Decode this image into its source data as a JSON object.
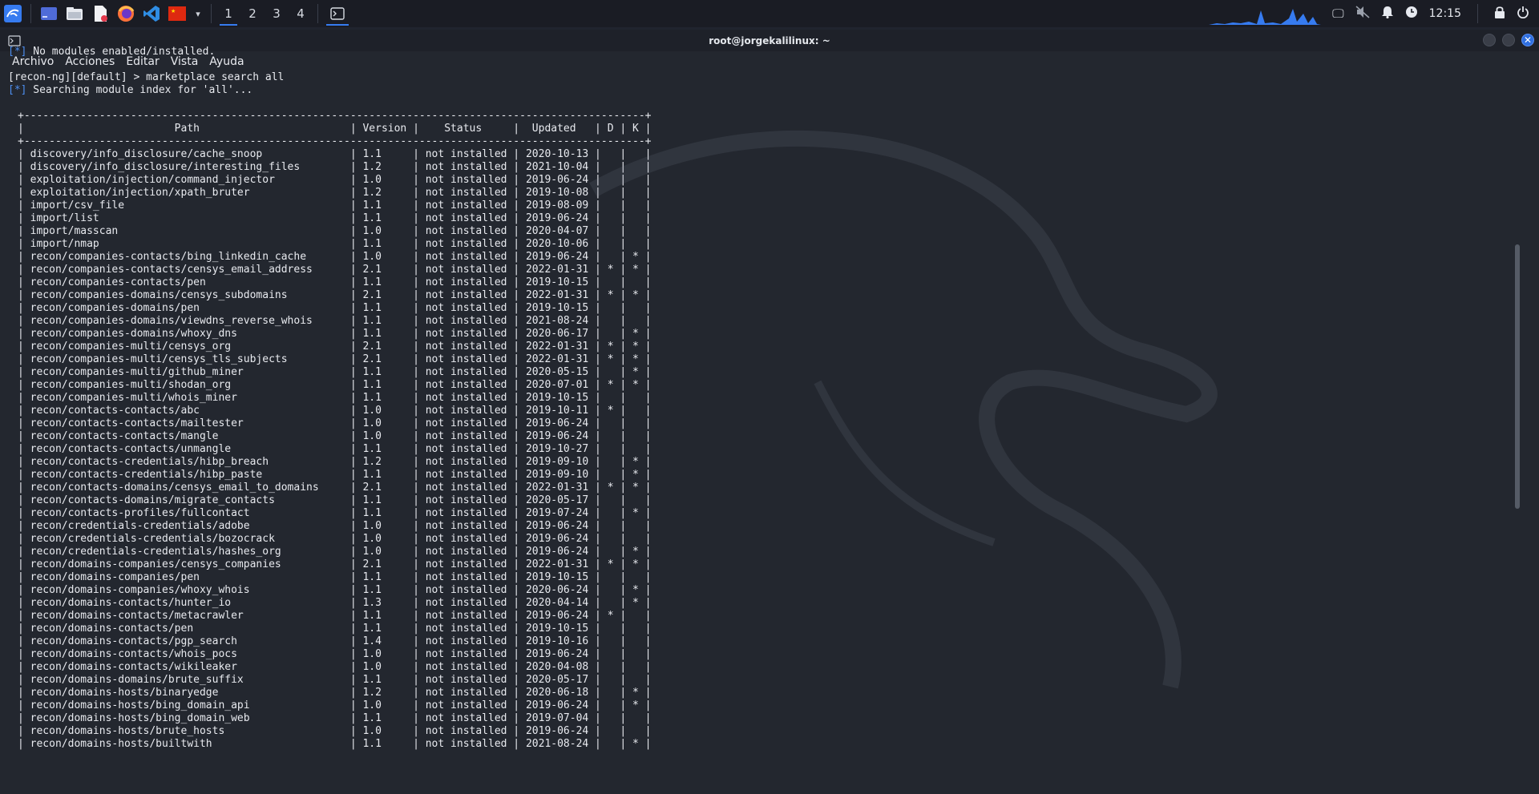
{
  "taskbar": {
    "workspaces": [
      "1",
      "2",
      "3",
      "4"
    ],
    "active_workspace": "1",
    "clock": "12:15",
    "apps": [
      "kali-menu-icon",
      "workspace-manager-icon",
      "file-manager-icon",
      "text-editor-icon",
      "firefox-icon",
      "vscode-icon",
      "flag-icon"
    ]
  },
  "window": {
    "title": "root@jorgekalilinux: ~",
    "menu": [
      "Archivo",
      "Acciones",
      "Editar",
      "Vista",
      "Ayuda"
    ]
  },
  "terminal": {
    "pre_lines": [
      {
        "prefix": "[*]",
        "text": " No modules enabled/installed."
      },
      {
        "prefix": "",
        "text": ""
      },
      {
        "prefix": "",
        "text": "[recon-ng][default] > marketplace search all"
      },
      {
        "prefix": "[*]",
        "text": " Searching module index for 'all'..."
      },
      {
        "prefix": "",
        "text": ""
      }
    ],
    "table_header": {
      "path": "Path",
      "version": "Version",
      "status": "Status",
      "updated": "Updated",
      "d": "D",
      "k": "K"
    },
    "rows": [
      {
        "path": "discovery/info_disclosure/cache_snoop",
        "version": "1.1",
        "status": "not installed",
        "updated": "2020-10-13",
        "d": "",
        "k": ""
      },
      {
        "path": "discovery/info_disclosure/interesting_files",
        "version": "1.2",
        "status": "not installed",
        "updated": "2021-10-04",
        "d": "",
        "k": ""
      },
      {
        "path": "exploitation/injection/command_injector",
        "version": "1.0",
        "status": "not installed",
        "updated": "2019-06-24",
        "d": "",
        "k": ""
      },
      {
        "path": "exploitation/injection/xpath_bruter",
        "version": "1.2",
        "status": "not installed",
        "updated": "2019-10-08",
        "d": "",
        "k": ""
      },
      {
        "path": "import/csv_file",
        "version": "1.1",
        "status": "not installed",
        "updated": "2019-08-09",
        "d": "",
        "k": ""
      },
      {
        "path": "import/list",
        "version": "1.1",
        "status": "not installed",
        "updated": "2019-06-24",
        "d": "",
        "k": ""
      },
      {
        "path": "import/masscan",
        "version": "1.0",
        "status": "not installed",
        "updated": "2020-04-07",
        "d": "",
        "k": ""
      },
      {
        "path": "import/nmap",
        "version": "1.1",
        "status": "not installed",
        "updated": "2020-10-06",
        "d": "",
        "k": ""
      },
      {
        "path": "recon/companies-contacts/bing_linkedin_cache",
        "version": "1.0",
        "status": "not installed",
        "updated": "2019-06-24",
        "d": "",
        "k": "*"
      },
      {
        "path": "recon/companies-contacts/censys_email_address",
        "version": "2.1",
        "status": "not installed",
        "updated": "2022-01-31",
        "d": "*",
        "k": "*"
      },
      {
        "path": "recon/companies-contacts/pen",
        "version": "1.1",
        "status": "not installed",
        "updated": "2019-10-15",
        "d": "",
        "k": ""
      },
      {
        "path": "recon/companies-domains/censys_subdomains",
        "version": "2.1",
        "status": "not installed",
        "updated": "2022-01-31",
        "d": "*",
        "k": "*"
      },
      {
        "path": "recon/companies-domains/pen",
        "version": "1.1",
        "status": "not installed",
        "updated": "2019-10-15",
        "d": "",
        "k": ""
      },
      {
        "path": "recon/companies-domains/viewdns_reverse_whois",
        "version": "1.1",
        "status": "not installed",
        "updated": "2021-08-24",
        "d": "",
        "k": ""
      },
      {
        "path": "recon/companies-domains/whoxy_dns",
        "version": "1.1",
        "status": "not installed",
        "updated": "2020-06-17",
        "d": "",
        "k": "*"
      },
      {
        "path": "recon/companies-multi/censys_org",
        "version": "2.1",
        "status": "not installed",
        "updated": "2022-01-31",
        "d": "*",
        "k": "*"
      },
      {
        "path": "recon/companies-multi/censys_tls_subjects",
        "version": "2.1",
        "status": "not installed",
        "updated": "2022-01-31",
        "d": "*",
        "k": "*"
      },
      {
        "path": "recon/companies-multi/github_miner",
        "version": "1.1",
        "status": "not installed",
        "updated": "2020-05-15",
        "d": "",
        "k": "*"
      },
      {
        "path": "recon/companies-multi/shodan_org",
        "version": "1.1",
        "status": "not installed",
        "updated": "2020-07-01",
        "d": "*",
        "k": "*"
      },
      {
        "path": "recon/companies-multi/whois_miner",
        "version": "1.1",
        "status": "not installed",
        "updated": "2019-10-15",
        "d": "",
        "k": ""
      },
      {
        "path": "recon/contacts-contacts/abc",
        "version": "1.0",
        "status": "not installed",
        "updated": "2019-10-11",
        "d": "*",
        "k": ""
      },
      {
        "path": "recon/contacts-contacts/mailtester",
        "version": "1.0",
        "status": "not installed",
        "updated": "2019-06-24",
        "d": "",
        "k": ""
      },
      {
        "path": "recon/contacts-contacts/mangle",
        "version": "1.0",
        "status": "not installed",
        "updated": "2019-06-24",
        "d": "",
        "k": ""
      },
      {
        "path": "recon/contacts-contacts/unmangle",
        "version": "1.1",
        "status": "not installed",
        "updated": "2019-10-27",
        "d": "",
        "k": ""
      },
      {
        "path": "recon/contacts-credentials/hibp_breach",
        "version": "1.2",
        "status": "not installed",
        "updated": "2019-09-10",
        "d": "",
        "k": "*"
      },
      {
        "path": "recon/contacts-credentials/hibp_paste",
        "version": "1.1",
        "status": "not installed",
        "updated": "2019-09-10",
        "d": "",
        "k": "*"
      },
      {
        "path": "recon/contacts-domains/censys_email_to_domains",
        "version": "2.1",
        "status": "not installed",
        "updated": "2022-01-31",
        "d": "*",
        "k": "*"
      },
      {
        "path": "recon/contacts-domains/migrate_contacts",
        "version": "1.1",
        "status": "not installed",
        "updated": "2020-05-17",
        "d": "",
        "k": ""
      },
      {
        "path": "recon/contacts-profiles/fullcontact",
        "version": "1.1",
        "status": "not installed",
        "updated": "2019-07-24",
        "d": "",
        "k": "*"
      },
      {
        "path": "recon/credentials-credentials/adobe",
        "version": "1.0",
        "status": "not installed",
        "updated": "2019-06-24",
        "d": "",
        "k": ""
      },
      {
        "path": "recon/credentials-credentials/bozocrack",
        "version": "1.0",
        "status": "not installed",
        "updated": "2019-06-24",
        "d": "",
        "k": ""
      },
      {
        "path": "recon/credentials-credentials/hashes_org",
        "version": "1.0",
        "status": "not installed",
        "updated": "2019-06-24",
        "d": "",
        "k": "*"
      },
      {
        "path": "recon/domains-companies/censys_companies",
        "version": "2.1",
        "status": "not installed",
        "updated": "2022-01-31",
        "d": "*",
        "k": "*"
      },
      {
        "path": "recon/domains-companies/pen",
        "version": "1.1",
        "status": "not installed",
        "updated": "2019-10-15",
        "d": "",
        "k": ""
      },
      {
        "path": "recon/domains-companies/whoxy_whois",
        "version": "1.1",
        "status": "not installed",
        "updated": "2020-06-24",
        "d": "",
        "k": "*"
      },
      {
        "path": "recon/domains-contacts/hunter_io",
        "version": "1.3",
        "status": "not installed",
        "updated": "2020-04-14",
        "d": "",
        "k": "*"
      },
      {
        "path": "recon/domains-contacts/metacrawler",
        "version": "1.1",
        "status": "not installed",
        "updated": "2019-06-24",
        "d": "*",
        "k": ""
      },
      {
        "path": "recon/domains-contacts/pen",
        "version": "1.1",
        "status": "not installed",
        "updated": "2019-10-15",
        "d": "",
        "k": ""
      },
      {
        "path": "recon/domains-contacts/pgp_search",
        "version": "1.4",
        "status": "not installed",
        "updated": "2019-10-16",
        "d": "",
        "k": ""
      },
      {
        "path": "recon/domains-contacts/whois_pocs",
        "version": "1.0",
        "status": "not installed",
        "updated": "2019-06-24",
        "d": "",
        "k": ""
      },
      {
        "path": "recon/domains-contacts/wikileaker",
        "version": "1.0",
        "status": "not installed",
        "updated": "2020-04-08",
        "d": "",
        "k": ""
      },
      {
        "path": "recon/domains-domains/brute_suffix",
        "version": "1.1",
        "status": "not installed",
        "updated": "2020-05-17",
        "d": "",
        "k": ""
      },
      {
        "path": "recon/domains-hosts/binaryedge",
        "version": "1.2",
        "status": "not installed",
        "updated": "2020-06-18",
        "d": "",
        "k": "*"
      },
      {
        "path": "recon/domains-hosts/bing_domain_api",
        "version": "1.0",
        "status": "not installed",
        "updated": "2019-06-24",
        "d": "",
        "k": "*"
      },
      {
        "path": "recon/domains-hosts/bing_domain_web",
        "version": "1.1",
        "status": "not installed",
        "updated": "2019-07-04",
        "d": "",
        "k": ""
      },
      {
        "path": "recon/domains-hosts/brute_hosts",
        "version": "1.0",
        "status": "not installed",
        "updated": "2019-06-24",
        "d": "",
        "k": ""
      },
      {
        "path": "recon/domains-hosts/builtwith",
        "version": "1.1",
        "status": "not installed",
        "updated": "2021-08-24",
        "d": "",
        "k": "*"
      }
    ]
  }
}
